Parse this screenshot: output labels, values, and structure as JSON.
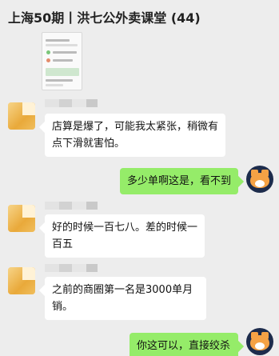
{
  "header": {
    "title": "上海50期丨洪七公外卖课堂 (44)"
  },
  "messages": [
    {
      "side": "in",
      "text": "店算是爆了，可能我太紧张，稍微有点下滑就害怕。"
    },
    {
      "side": "out",
      "text": "多少单啊这是，看不到"
    },
    {
      "side": "in",
      "text": "好的时候一百七八。差的时候一百五"
    },
    {
      "side": "in",
      "text": "之前的商圈第一名是3000单月销。"
    },
    {
      "side": "out",
      "text": "你这可以，直接绞杀"
    }
  ],
  "colors": {
    "background": "#ededed",
    "incoming_bubble": "#ffffff",
    "outgoing_bubble": "#95ec69"
  },
  "icons": {
    "sender_avatar": "blurred-avatar-icon",
    "self_avatar": "shiba-dog-avatar-icon"
  }
}
